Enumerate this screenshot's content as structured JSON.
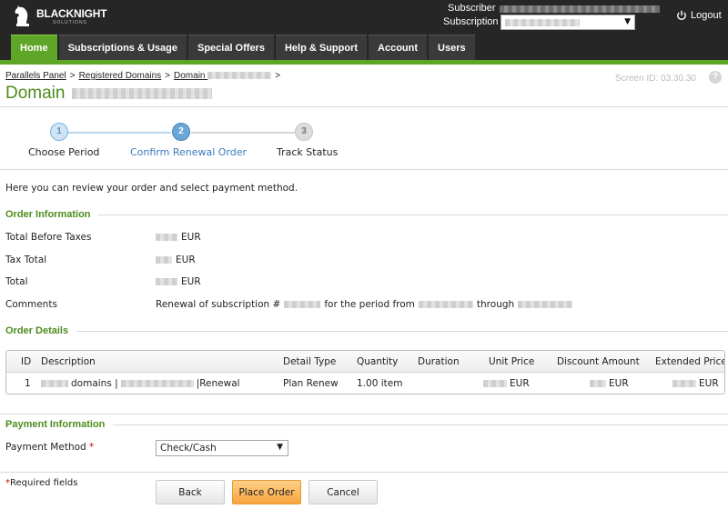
{
  "brand": {
    "name": "BLACKNIGHT",
    "tagline": "SOLUTIONS"
  },
  "header": {
    "subscriber_label": "Subscriber",
    "subscription_label": "Subscription",
    "logout_label": "Logout"
  },
  "nav": {
    "tabs": [
      {
        "label": "Home",
        "active": true
      },
      {
        "label": "Subscriptions & Usage"
      },
      {
        "label": "Special Offers"
      },
      {
        "label": "Help & Support"
      },
      {
        "label": "Account"
      },
      {
        "label": "Users"
      }
    ]
  },
  "breadcrumb": {
    "items": [
      "Parallels Panel",
      "Registered Domains",
      "Domain"
    ],
    "separator": ">"
  },
  "screen_id": "Screen ID:  03.30.30",
  "help_icon": "?",
  "page_title": "Domain",
  "wizard": {
    "steps": [
      {
        "number": "1",
        "label": "Choose Period",
        "state": "done"
      },
      {
        "number": "2",
        "label": "Confirm Renewal Order",
        "state": "current"
      },
      {
        "number": "3",
        "label": "Track Status",
        "state": "todo"
      }
    ]
  },
  "intro": "Here you can review your order and select payment method.",
  "order_information": {
    "title": "Order Information",
    "rows": [
      {
        "label": "Total Before Taxes",
        "currency": "EUR"
      },
      {
        "label": "Tax Total",
        "currency": "EUR"
      },
      {
        "label": "Total",
        "currency": "EUR"
      }
    ],
    "comments_label": "Comments",
    "comments_parts": [
      "Renewal of subscription #",
      "for the period from",
      "through"
    ]
  },
  "order_details": {
    "title": "Order Details",
    "columns": [
      "ID",
      "Description",
      "Detail Type",
      "Quantity",
      "Duration",
      "Unit Price",
      "Discount Amount",
      "Extended Price"
    ],
    "row": {
      "id": "1",
      "desc_a": "domains |",
      "desc_b": "|Renewal",
      "detail_type": "Plan Renew",
      "quantity": "1.00 item",
      "unit_price_currency": "EUR",
      "discount_currency": "EUR",
      "extended_currency": "EUR"
    }
  },
  "payment": {
    "title": "Payment Information",
    "method_label": "Payment Method",
    "required_mark": "*",
    "method_value": "Check/Cash"
  },
  "footer": {
    "required_note": "*Required fields",
    "buttons": {
      "back": "Back",
      "place_order": "Place Order",
      "cancel": "Cancel"
    }
  },
  "colors": {
    "brand_green": "#5fa528",
    "title_green": "#4c8d1c",
    "wizard_active": "#6aa6d6",
    "primary_button": "#f7a33d"
  }
}
